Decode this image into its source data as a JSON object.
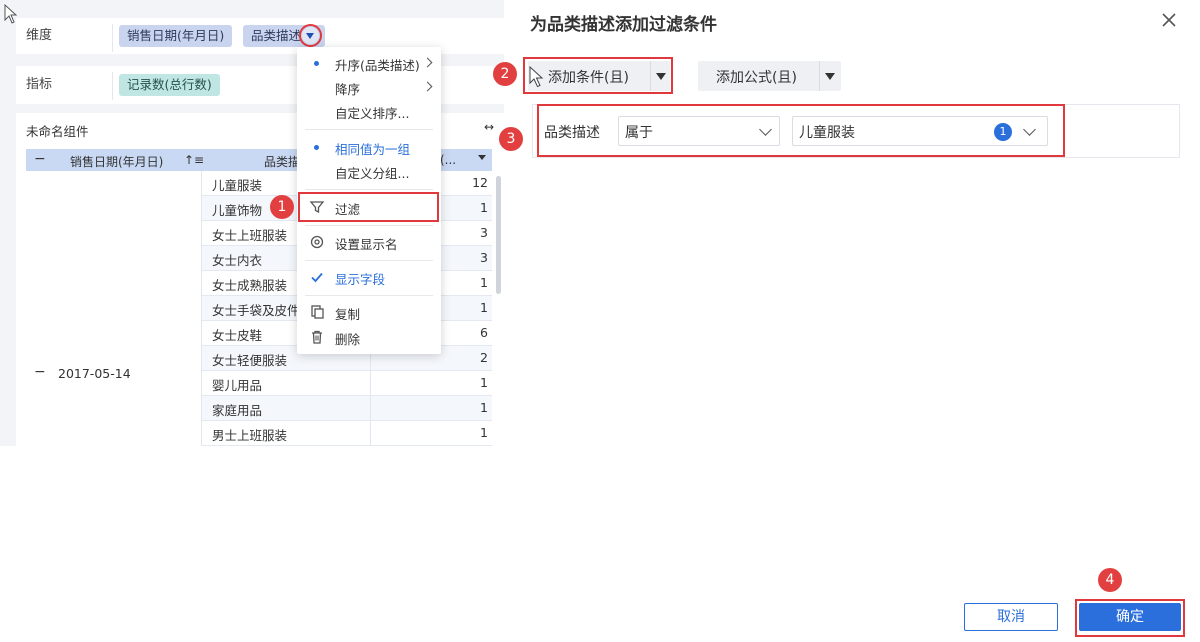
{
  "dimension_row": {
    "label": "维度",
    "pills": [
      "销售日期(年月日)",
      "品类描述"
    ]
  },
  "measure_row": {
    "label": "指标",
    "pills": [
      "记录数(总行数)"
    ]
  },
  "widget": {
    "title": "未命名组件",
    "columns": [
      "销售日期(年月日)",
      "品类描",
      "(..."
    ],
    "date_value": "2017-05-14",
    "rows": [
      {
        "name": "儿童服装",
        "value": "12"
      },
      {
        "name": "儿童饰物",
        "value": "1"
      },
      {
        "name": "女士上班服装",
        "value": "3"
      },
      {
        "name": "女士内衣",
        "value": "3"
      },
      {
        "name": "女士成熟服装",
        "value": "1"
      },
      {
        "name": "女士手袋及皮件",
        "value": "1"
      },
      {
        "name": "女士皮鞋",
        "value": "6"
      },
      {
        "name": "女士轻便服装",
        "value": "2"
      },
      {
        "name": "婴儿用品",
        "value": "1"
      },
      {
        "name": "家庭用品",
        "value": "1"
      },
      {
        "name": "男士上班服装",
        "value": "1"
      }
    ]
  },
  "context_menu": {
    "items": [
      {
        "label": "升序(品类描述)"
      },
      {
        "label": "降序"
      },
      {
        "label": "自定义排序..."
      },
      {
        "label": "相同值为一组"
      },
      {
        "label": "自定义分组..."
      },
      {
        "label": "过滤"
      },
      {
        "label": "设置显示名"
      },
      {
        "label": "显示字段"
      },
      {
        "label": "复制"
      },
      {
        "label": "删除"
      }
    ]
  },
  "dialog": {
    "title": "为品类描述添加过滤条件",
    "add_condition_label": "添加条件(且)",
    "add_formula_label": "添加公式(且)",
    "condition": {
      "field": "品类描述",
      "operator": "属于",
      "value": "儿童服装",
      "selected_count": "1"
    },
    "cancel_label": "取消",
    "ok_label": "确定"
  },
  "callouts": [
    "1",
    "2",
    "3",
    "4"
  ],
  "colors": {
    "accent": "#2a6fdb",
    "callout": "#e0383c",
    "dimension_pill": "#c9d4ef",
    "measure_pill": "#bfe6e3"
  }
}
